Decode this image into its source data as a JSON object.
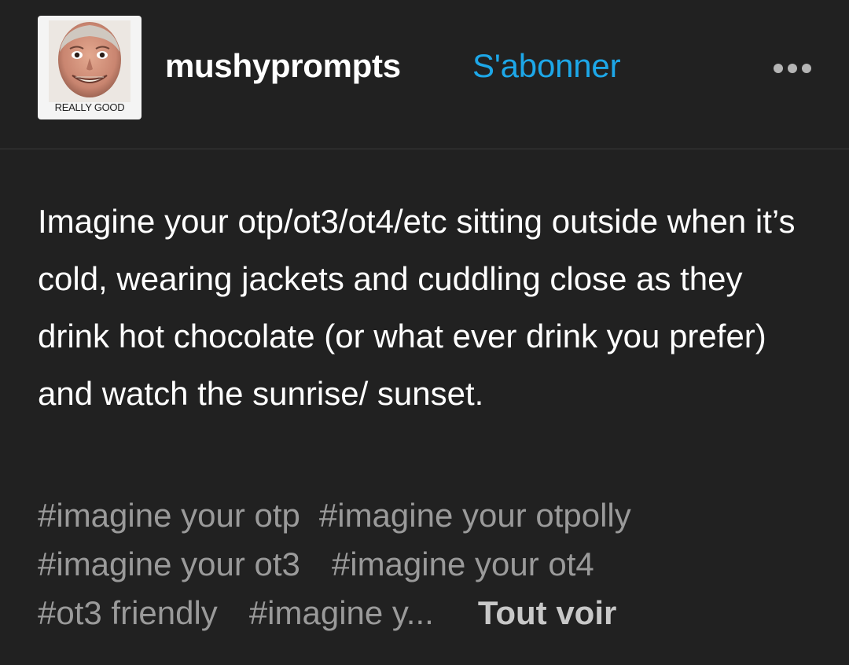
{
  "post": {
    "author": {
      "username": "mushyprompts",
      "avatar_caption": "REALLY GOOD",
      "avatar_icon": "grinning-face-avatar"
    },
    "follow_label": "S'abonner",
    "more_icon": "more-horizontal-icon",
    "body": "Imagine your otp/ot3/ot4/etc sitting outside when it’s cold, wearing jackets and cuddling close as they drink hot chocolate (or what ever drink you prefer) and watch the sunrise/ sunset.",
    "tags": [
      "#imagine your otp",
      "#imagine your otpolly",
      "#imagine your ot3",
      "#imagine your ot4",
      "#ot3 friendly",
      "#imagine y..."
    ],
    "see_all_label": "Tout voir"
  },
  "colors": {
    "background": "#212121",
    "accent": "#1da7e8",
    "tag_text": "#9a9a9a"
  }
}
